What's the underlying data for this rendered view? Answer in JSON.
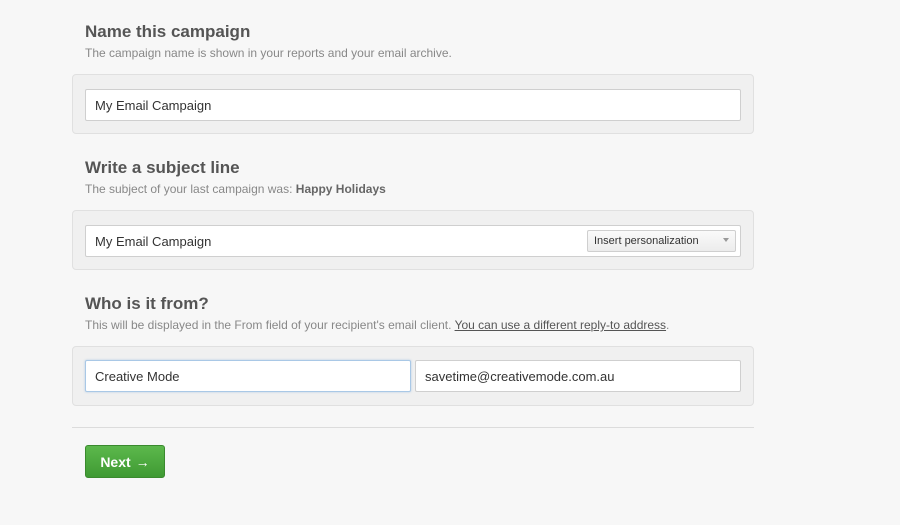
{
  "name_section": {
    "title": "Name this campaign",
    "description": "The campaign name is shown in your reports and your email archive.",
    "campaign_name_value": "My Email Campaign"
  },
  "subject_section": {
    "title": "Write a subject line",
    "description_prefix": "The subject of your last campaign was: ",
    "last_subject": "Happy Holidays",
    "subject_value": "My Email Campaign",
    "personalization_select": "Insert personalization"
  },
  "from_section": {
    "title": "Who is it from?",
    "description_prefix": "This will be displayed in the From field of your recipient's email client. ",
    "reply_to_link": "You can use a different reply-to address",
    "description_suffix": ".",
    "from_name_value": "Creative Mode",
    "from_email_value": "savetime@creativemode.com.au"
  },
  "actions": {
    "next_label": "Next",
    "next_arrow": "→"
  }
}
